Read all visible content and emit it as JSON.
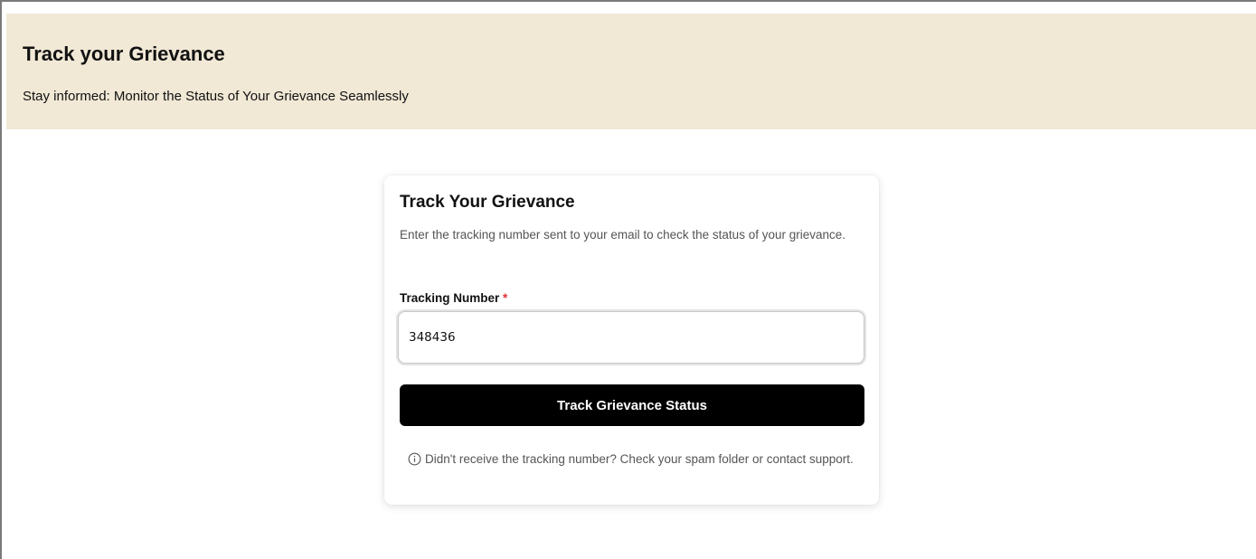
{
  "banner": {
    "title": "Track your Grievance",
    "subtitle": "Stay informed: Monitor the Status of Your Grievance Seamlessly",
    "background_color": "#f1e8d6"
  },
  "card": {
    "title": "Track Your Grievance",
    "description": "Enter the tracking number sent to your email to check the status of your grievance.",
    "field": {
      "label": "Tracking Number",
      "required_mark": "*",
      "value": "348436"
    },
    "button_label": "Track Grievance Status",
    "help": {
      "icon": "info-circle-icon",
      "text": "Didn't receive the tracking number? Check your spam folder or contact support."
    }
  },
  "colors": {
    "button_bg": "#000000",
    "button_text": "#ffffff",
    "required": "#e03131",
    "muted_text": "#555555"
  }
}
